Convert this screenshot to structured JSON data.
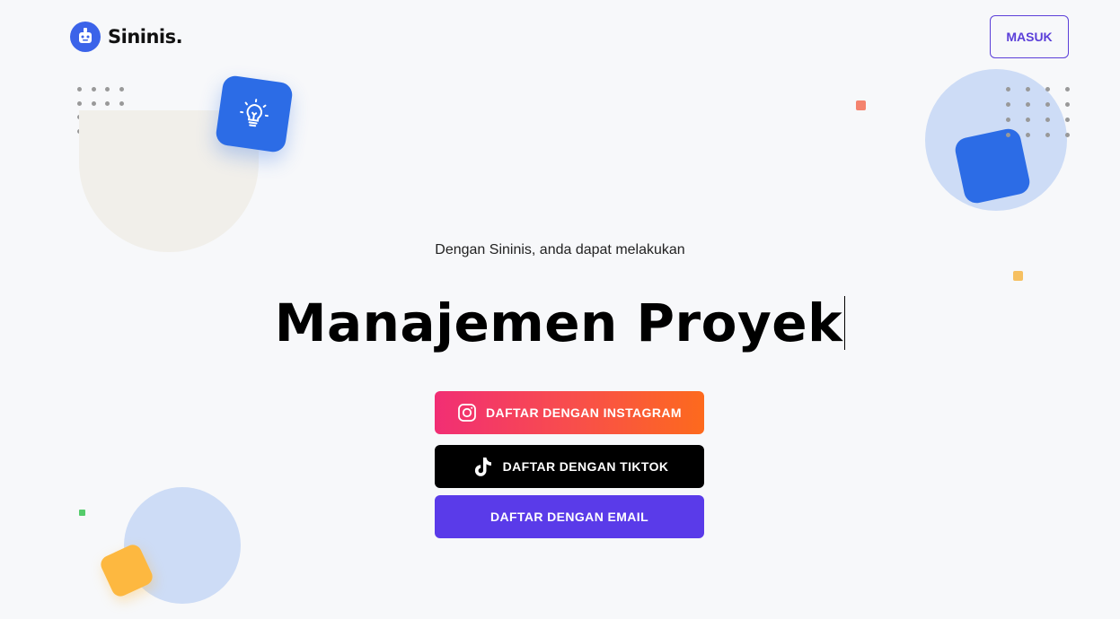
{
  "brand": {
    "name": "Sininis.",
    "logo_icon": "robot-icon"
  },
  "header": {
    "login_label": "MASUK"
  },
  "hero": {
    "subtitle": "Dengan Sininis, anda dapat melakukan",
    "headline": "Manajemen Proyek"
  },
  "actions": {
    "instagram": {
      "label": "DAFTAR DENGAN INSTAGRAM",
      "icon": "instagram-icon"
    },
    "tiktok": {
      "label": "DAFTAR DENGAN TIKTOK",
      "icon": "tiktok-icon"
    },
    "email": {
      "label": "DAFTAR DENGAN EMAIL"
    }
  },
  "decorations": {
    "tile_icon": "lightbulb-icon"
  },
  "colors": {
    "primary": "#5a3be9",
    "accent_blue": "#2c6ce6",
    "instagram_gradient_start": "#f12e74",
    "instagram_gradient_end": "#fd6a1d",
    "tiktok": "#000000"
  }
}
